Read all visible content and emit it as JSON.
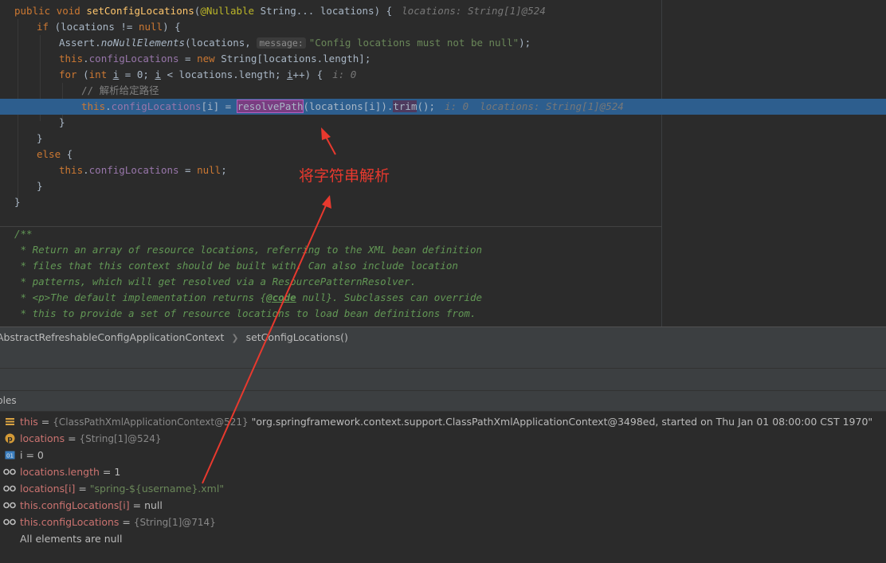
{
  "editor": {
    "code": {
      "l1": {
        "kw1": "public",
        "kw2": "void",
        "name": "setConfigLocations",
        "p1": "(",
        "ann": "@Nullable",
        "p2": " String... locations) {",
        "inlay": "locations: String[1]@524"
      },
      "l2": {
        "kw": "if",
        "rest1": " (locations != ",
        "nul": "null",
        "rest2": ") {"
      },
      "l3": {
        "pre": "Assert.",
        "call": "noNullElements",
        "mid": "(locations, ",
        "hint": "message:",
        "str": "\"Config locations must not be null\"",
        "end": ");"
      },
      "l4": {
        "this": "this",
        "dot": ".",
        "fld": "configLocations",
        "eq": " = ",
        "nw": "new",
        "rest": " String[locations.length];"
      },
      "l5": {
        "kw": "for",
        "p1": " (",
        "int": "int",
        "sp": " ",
        "i1": "i",
        "mid1": " = 0; ",
        "i2": "i",
        "mid2": " < locations.length; ",
        "i3": "i",
        "end": "++) {",
        "inlay": "i: 0"
      },
      "l6": {
        "cmt": "// 解析给定路径"
      },
      "l7": {
        "this": "this",
        "dot": ".",
        "fld": "configLocations",
        "idx": "[i] = ",
        "call": "resolvePath",
        "args": "(locations[i])",
        "dot2": ".",
        "trim": "trim",
        "end": "();",
        "inlay1": "i: 0",
        "inlay2": "locations: String[1]@524"
      },
      "l8": {
        "t": "}"
      },
      "l9": {
        "t": "}"
      },
      "l10": {
        "kw": "else",
        "rest": " {"
      },
      "l11": {
        "this": "this",
        "dot": ".",
        "fld": "configLocations",
        "eq": " = ",
        "nul": "null",
        "end": ";"
      },
      "l12": {
        "t": "}"
      },
      "l13": {
        "t": "}"
      },
      "d1": "/**",
      "d2": " * Return an array of resource locations, referring to the XML bean definition",
      "d3": " * files that this context should be built with. Can also include location",
      "d4": " * patterns, which will get resolved via a ResourcePatternResolver.",
      "d5a": " * <p>The default implementation returns {",
      "d5tag": "@code",
      "d5b": " null}. Subclasses can override",
      "d6": " * this to provide a set of resource locations to load bean definitions from."
    }
  },
  "breadcrumb": {
    "class_name": "AbstractRefreshableConfigApplicationContext",
    "method_name": "setConfigLocations()"
  },
  "variables_panel": {
    "title": "bles",
    "items": [
      {
        "icon": "stack-frame-icon",
        "name": "this",
        "eq": " = ",
        "type": "{ClassPathXmlApplicationContext@521}",
        "value": " \"org.springframework.context.support.ClassPathXmlApplicationContext@3498ed, started on Thu Jan 01 08:00:00 CST 1970\""
      },
      {
        "icon": "parameter-icon",
        "name": "locations",
        "eq": " = ",
        "type": "{String[1]@524}",
        "value": ""
      },
      {
        "icon": "primitive-int-icon",
        "name": "i",
        "eq": " = ",
        "type": "",
        "value": "0"
      },
      {
        "icon": "watch-icon",
        "name": "locations.length",
        "eq": " = ",
        "type": "",
        "value": "1"
      },
      {
        "icon": "watch-icon",
        "name": "locations[i]",
        "eq": " = ",
        "type": "",
        "value": "\"spring-${username}.xml\""
      },
      {
        "icon": "watch-icon",
        "name": "this.configLocations[i]",
        "eq": " = ",
        "type": "",
        "value": "null"
      },
      {
        "icon": "watch-icon",
        "name": "this.configLocations",
        "eq": " = ",
        "type": "{String[1]@714}",
        "value": ""
      },
      {
        "icon": "",
        "name": "",
        "eq": "",
        "type": "",
        "value": "All elements are null"
      }
    ]
  },
  "annotation": {
    "text": "将字符串解析",
    "color": "#e8392e"
  },
  "colors": {
    "editor_bg": "#2b2b2b",
    "current_line": "#2d5e8e",
    "keyword": "#cc7832",
    "string": "#6a8759",
    "field": "#9876aa"
  }
}
